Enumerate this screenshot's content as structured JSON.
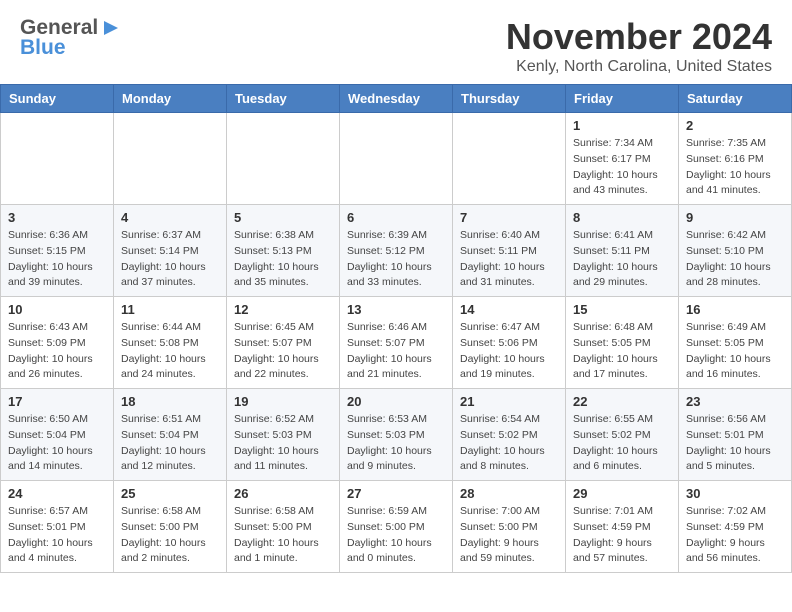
{
  "header": {
    "logo": {
      "line1": "General",
      "line2": "Blue"
    },
    "title": "November 2024",
    "location": "Kenly, North Carolina, United States"
  },
  "calendar": {
    "weekdays": [
      "Sunday",
      "Monday",
      "Tuesday",
      "Wednesday",
      "Thursday",
      "Friday",
      "Saturday"
    ],
    "weeks": [
      [
        {
          "day": "",
          "info": ""
        },
        {
          "day": "",
          "info": ""
        },
        {
          "day": "",
          "info": ""
        },
        {
          "day": "",
          "info": ""
        },
        {
          "day": "",
          "info": ""
        },
        {
          "day": "1",
          "info": "Sunrise: 7:34 AM\nSunset: 6:17 PM\nDaylight: 10 hours\nand 43 minutes."
        },
        {
          "day": "2",
          "info": "Sunrise: 7:35 AM\nSunset: 6:16 PM\nDaylight: 10 hours\nand 41 minutes."
        }
      ],
      [
        {
          "day": "3",
          "info": "Sunrise: 6:36 AM\nSunset: 5:15 PM\nDaylight: 10 hours\nand 39 minutes."
        },
        {
          "day": "4",
          "info": "Sunrise: 6:37 AM\nSunset: 5:14 PM\nDaylight: 10 hours\nand 37 minutes."
        },
        {
          "day": "5",
          "info": "Sunrise: 6:38 AM\nSunset: 5:13 PM\nDaylight: 10 hours\nand 35 minutes."
        },
        {
          "day": "6",
          "info": "Sunrise: 6:39 AM\nSunset: 5:12 PM\nDaylight: 10 hours\nand 33 minutes."
        },
        {
          "day": "7",
          "info": "Sunrise: 6:40 AM\nSunset: 5:11 PM\nDaylight: 10 hours\nand 31 minutes."
        },
        {
          "day": "8",
          "info": "Sunrise: 6:41 AM\nSunset: 5:11 PM\nDaylight: 10 hours\nand 29 minutes."
        },
        {
          "day": "9",
          "info": "Sunrise: 6:42 AM\nSunset: 5:10 PM\nDaylight: 10 hours\nand 28 minutes."
        }
      ],
      [
        {
          "day": "10",
          "info": "Sunrise: 6:43 AM\nSunset: 5:09 PM\nDaylight: 10 hours\nand 26 minutes."
        },
        {
          "day": "11",
          "info": "Sunrise: 6:44 AM\nSunset: 5:08 PM\nDaylight: 10 hours\nand 24 minutes."
        },
        {
          "day": "12",
          "info": "Sunrise: 6:45 AM\nSunset: 5:07 PM\nDaylight: 10 hours\nand 22 minutes."
        },
        {
          "day": "13",
          "info": "Sunrise: 6:46 AM\nSunset: 5:07 PM\nDaylight: 10 hours\nand 21 minutes."
        },
        {
          "day": "14",
          "info": "Sunrise: 6:47 AM\nSunset: 5:06 PM\nDaylight: 10 hours\nand 19 minutes."
        },
        {
          "day": "15",
          "info": "Sunrise: 6:48 AM\nSunset: 5:05 PM\nDaylight: 10 hours\nand 17 minutes."
        },
        {
          "day": "16",
          "info": "Sunrise: 6:49 AM\nSunset: 5:05 PM\nDaylight: 10 hours\nand 16 minutes."
        }
      ],
      [
        {
          "day": "17",
          "info": "Sunrise: 6:50 AM\nSunset: 5:04 PM\nDaylight: 10 hours\nand 14 minutes."
        },
        {
          "day": "18",
          "info": "Sunrise: 6:51 AM\nSunset: 5:04 PM\nDaylight: 10 hours\nand 12 minutes."
        },
        {
          "day": "19",
          "info": "Sunrise: 6:52 AM\nSunset: 5:03 PM\nDaylight: 10 hours\nand 11 minutes."
        },
        {
          "day": "20",
          "info": "Sunrise: 6:53 AM\nSunset: 5:03 PM\nDaylight: 10 hours\nand 9 minutes."
        },
        {
          "day": "21",
          "info": "Sunrise: 6:54 AM\nSunset: 5:02 PM\nDaylight: 10 hours\nand 8 minutes."
        },
        {
          "day": "22",
          "info": "Sunrise: 6:55 AM\nSunset: 5:02 PM\nDaylight: 10 hours\nand 6 minutes."
        },
        {
          "day": "23",
          "info": "Sunrise: 6:56 AM\nSunset: 5:01 PM\nDaylight: 10 hours\nand 5 minutes."
        }
      ],
      [
        {
          "day": "24",
          "info": "Sunrise: 6:57 AM\nSunset: 5:01 PM\nDaylight: 10 hours\nand 4 minutes."
        },
        {
          "day": "25",
          "info": "Sunrise: 6:58 AM\nSunset: 5:00 PM\nDaylight: 10 hours\nand 2 minutes."
        },
        {
          "day": "26",
          "info": "Sunrise: 6:58 AM\nSunset: 5:00 PM\nDaylight: 10 hours\nand 1 minute."
        },
        {
          "day": "27",
          "info": "Sunrise: 6:59 AM\nSunset: 5:00 PM\nDaylight: 10 hours\nand 0 minutes."
        },
        {
          "day": "28",
          "info": "Sunrise: 7:00 AM\nSunset: 5:00 PM\nDaylight: 9 hours\nand 59 minutes."
        },
        {
          "day": "29",
          "info": "Sunrise: 7:01 AM\nSunset: 4:59 PM\nDaylight: 9 hours\nand 57 minutes."
        },
        {
          "day": "30",
          "info": "Sunrise: 7:02 AM\nSunset: 4:59 PM\nDaylight: 9 hours\nand 56 minutes."
        }
      ]
    ]
  }
}
